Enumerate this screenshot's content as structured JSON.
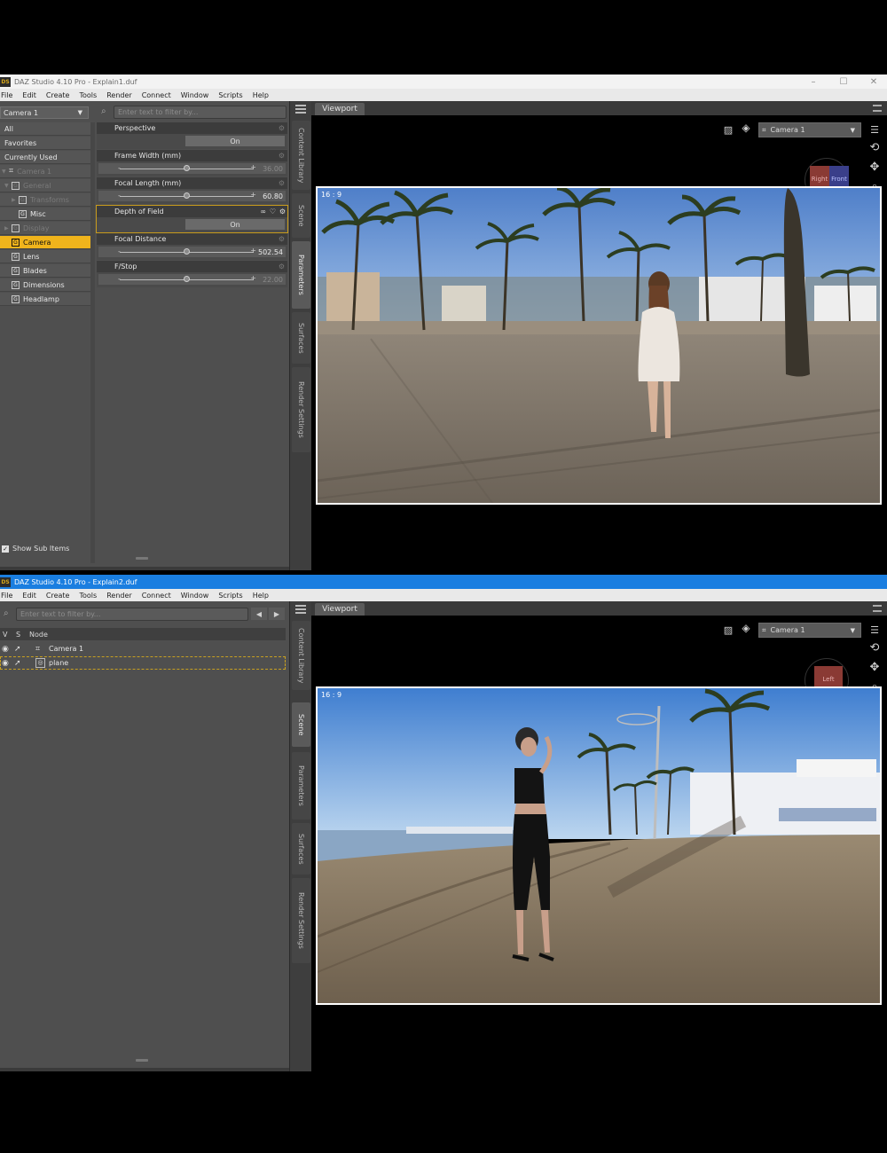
{
  "window1": {
    "title": "DAZ Studio 4.10 Pro - Explain1.duf",
    "menu": [
      "File",
      "Edit",
      "Create",
      "Tools",
      "Render",
      "Connect",
      "Window",
      "Scripts",
      "Help"
    ],
    "camera_combo": "Camera 1",
    "search_placeholder": "Enter text to filter by...",
    "categories": [
      {
        "label": "All"
      },
      {
        "label": "Favorites"
      },
      {
        "label": "Currently Used"
      },
      {
        "label": "Camera 1"
      },
      {
        "label": "General"
      },
      {
        "label": "Transforms"
      },
      {
        "label": "Misc"
      },
      {
        "label": "Display"
      },
      {
        "label": "Camera"
      },
      {
        "label": "Lens"
      },
      {
        "label": "Blades"
      },
      {
        "label": "Dimensions"
      },
      {
        "label": "Headlamp"
      }
    ],
    "params": [
      {
        "label": "Perspective",
        "toggle": "On"
      },
      {
        "label": "Frame Width (mm)",
        "value": "36.00",
        "level": 0.5
      },
      {
        "label": "Focal Length (mm)",
        "value": "60.80",
        "level": 0.5
      },
      {
        "label": "Depth of Field",
        "toggle": "On"
      },
      {
        "label": "Focal Distance",
        "value": "502.54",
        "level": 0.5
      },
      {
        "label": "F/Stop",
        "value": "22.00",
        "level": 0.5
      }
    ],
    "show_sub_items": "Show Sub Items",
    "side_tabs": [
      "Content Library",
      "Scene",
      "Parameters",
      "Surfaces",
      "Render Settings"
    ],
    "viewport_tab": "Viewport",
    "viewport_camera": "Camera 1",
    "ratio_label": "16 : 9",
    "cube_labels": [
      "Right",
      "Front"
    ]
  },
  "window2": {
    "title": "DAZ Studio 4.10 Pro - Explain2.duf",
    "menu": [
      "File",
      "Edit",
      "Create",
      "Tools",
      "Render",
      "Connect",
      "Window",
      "Scripts",
      "Help"
    ],
    "search_placeholder": "Enter text to filter by...",
    "columns": [
      "V",
      "S",
      "Node"
    ],
    "nodes": [
      {
        "label": "Camera 1"
      },
      {
        "label": "plane"
      }
    ],
    "side_tabs": [
      "Content Library",
      "Scene",
      "Parameters",
      "Surfaces",
      "Render Settings"
    ],
    "viewport_tab": "Viewport",
    "viewport_camera": "Camera 1",
    "ratio_label": "16 : 9",
    "cube_labels": [
      "Left"
    ]
  },
  "colors": {
    "accent": "#f0b41c",
    "title_active": "#1a7ee0",
    "panel": "#4f4f4f"
  }
}
